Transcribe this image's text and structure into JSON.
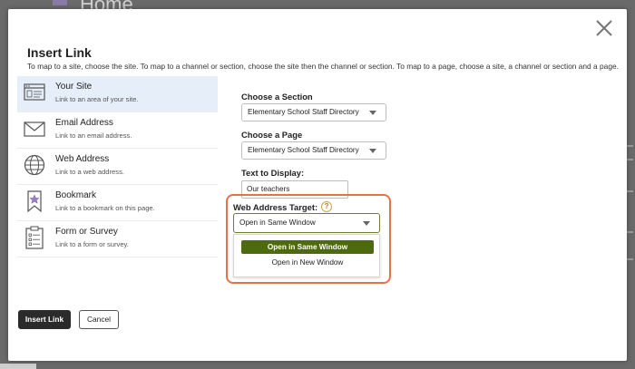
{
  "background": {
    "page_title": "Home"
  },
  "dialog": {
    "title": "Insert Link",
    "description": "To map to a site, choose the site. To map to a channel or section, choose the site then the channel or section. To map to a page, choose a site, a channel or section and a page.",
    "link_types": [
      {
        "title": "Your Site",
        "subtitle": "Link to an area of your site.",
        "icon": "browser-window-icon",
        "active": true
      },
      {
        "title": "Email Address",
        "subtitle": "Link to an email address.",
        "icon": "envelope-icon",
        "active": false
      },
      {
        "title": "Web Address",
        "subtitle": "Link to a web address.",
        "icon": "globe-icon",
        "active": false
      },
      {
        "title": "Bookmark",
        "subtitle": "Link to a bookmark on this page.",
        "icon": "bookmark-icon",
        "active": false
      },
      {
        "title": "Form or Survey",
        "subtitle": "Link to a form or survey.",
        "icon": "clipboard-icon",
        "active": false
      }
    ],
    "section": {
      "label": "Choose a Section",
      "value": "Elementary School Staff Directory"
    },
    "page": {
      "label": "Choose a Page",
      "value": "Elementary School Staff Directory"
    },
    "display_text": {
      "label": "Text to Display:",
      "value": "Our teachers"
    },
    "target": {
      "label": "Web Address Target:",
      "help": "?",
      "value": "Open in Same Window",
      "options": [
        "Open in Same Window",
        "Open in New Window"
      ]
    },
    "buttons": {
      "insert": "Insert Link",
      "cancel": "Cancel"
    }
  },
  "colors": {
    "accent_green": "#4e6a0e",
    "highlight_orange": "#e4734a",
    "active_row": "#e6eefa"
  }
}
